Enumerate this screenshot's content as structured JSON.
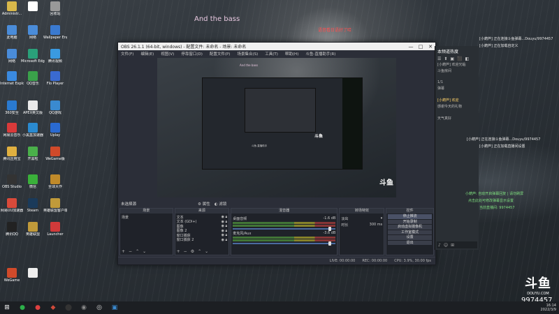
{
  "lyric": "And the bass",
  "danmaku": [
    {
      "text": "语音看日语好了哈",
      "color": "#ff5050"
    }
  ],
  "desktop_icons": [
    {
      "label": "Administr...",
      "color": "#d9b84a"
    },
    {
      "label": "此电脑",
      "color": "#4a8cd9"
    },
    {
      "label": "网络",
      "color": "#4a8cd9"
    },
    {
      "label": "Internet Explorer",
      "color": "#3a8ae0"
    },
    {
      "label": "360安全",
      "color": "#2a7ad0"
    },
    {
      "label": "网易云音乐",
      "color": "#d93a3a"
    },
    {
      "label": "腾讯应用宝",
      "color": "#e0b040"
    },
    {
      "label": "OBS Studio",
      "color": "#333"
    },
    {
      "label": "网易UU加速器",
      "color": "#d94a3a"
    },
    {
      "label": "腾讯QQ",
      "color": "#222"
    },
    {
      "label": "WeGame",
      "color": "#d04a2a"
    },
    {
      "label": "",
      "color": "#ffffff"
    },
    {
      "label": "网络",
      "color": "#4a8cd9"
    },
    {
      "label": "Microsoft Edge",
      "color": "#2aa07a"
    },
    {
      "label": "QQ音乐",
      "color": "#3aa04a"
    },
    {
      "label": "APEX英文版",
      "color": "#eaeaea"
    },
    {
      "label": "小黑盒加速器",
      "color": "#2a8ad0"
    },
    {
      "label": "开黑啦",
      "color": "#4ab04a"
    },
    {
      "label": "微信",
      "color": "#3ab03a"
    },
    {
      "label": "Steam",
      "color": "#1a3a5a"
    },
    {
      "label": "英雄联盟",
      "color": "#c09a3a"
    },
    {
      "label": "",
      "color": "#eeeeee"
    },
    {
      "label": "回收站",
      "color": "#999999"
    },
    {
      "label": "Wallpaper Engine",
      "color": "#3a7ad0"
    },
    {
      "label": "腾讯视频",
      "color": "#3a9ae0"
    },
    {
      "label": "Flo Player",
      "color": "#3a6ad0"
    },
    {
      "label": "QQ游戏",
      "color": "#3a8ad0"
    },
    {
      "label": "Uplay",
      "color": "#2a6ad0"
    },
    {
      "label": "WeGame版",
      "color": "#d04a2a"
    },
    {
      "label": "全球大作",
      "color": "#c08a2a"
    },
    {
      "label": "英雄联盟客户端",
      "color": "#c09a3a"
    },
    {
      "label": "Launcher",
      "color": "#d03a3a"
    }
  ],
  "obs": {
    "title": "OBS 26.1.1 (64-bit, windows) - 配置文件: 未命名 - 场景: 未命名",
    "menu": [
      "文件(F)",
      "编辑(E)",
      "视图(V)",
      "停靠窗口(D)",
      "配置文件(P)",
      "场景集合(S)",
      "工具(T)",
      "帮助(H)",
      "斗鱼-直播助手(R)"
    ],
    "window_buttons": [
      "—",
      "□",
      "✕"
    ],
    "preview_lyric": "And the bass",
    "preview_logo": "斗鱼",
    "nested_logo": "斗鱼",
    "nested_label": "斗鱼-直播助手",
    "program_label": "未选择源",
    "program_buttons": [
      "属性",
      "滤镜"
    ],
    "docks": {
      "scenes": {
        "header": "场景",
        "items": [
          "场景"
        ]
      },
      "sources": {
        "header": "来源",
        "items": [
          "文本",
          "文本 (GDI+)",
          "图像",
          "图像 2",
          "窗口捕获",
          "窗口捕获 2"
        ]
      },
      "mixer": {
        "header": "混音器",
        "tracks": [
          {
            "name": "桌面音频",
            "db": "-1.6 dB"
          },
          {
            "name": "麦克风/Aux",
            "db": "-3.6 dB"
          }
        ]
      },
      "transitions": {
        "header": "转场特效",
        "type": "淡出",
        "duration_label": "时长",
        "duration_value": "300 ms"
      },
      "controls": {
        "header": "控件",
        "buttons": [
          "停止推流",
          "开始录制",
          "启动虚拟摄像机",
          "工作室模式",
          "设置",
          "退出"
        ]
      }
    },
    "status": [
      "LIVE: 00:00:00",
      "REC: 00:00:00",
      "CPU: 3.9%, 30.00 fps"
    ]
  },
  "chat": {
    "title": "本频道热度",
    "tools": [
      "☰",
      "⬆",
      "▣",
      "⬛",
      "◧"
    ],
    "lines": [
      {
        "text": "[小葫芦] 欢迎光临",
        "hl": false
      },
      {
        "text": "斗鱼房间",
        "hl": false
      },
      {
        "text": "",
        "hl": false
      },
      {
        "text": "1/1",
        "hl": false
      },
      {
        "text": "弹幕",
        "hl": false
      },
      {
        "text": "",
        "hl": false
      },
      {
        "text": "[小葫芦] 欢迎",
        "hl": true
      },
      {
        "text": "感谢今天的礼物",
        "hl": false
      },
      {
        "text": "",
        "hl": false
      },
      {
        "text": "天气真好",
        "hl": false
      }
    ],
    "input_icons": [
      "♪",
      "☺",
      "⊞"
    ]
  },
  "side_messages": [
    {
      "text": "[小葫芦] 正在连接斗鱼弹幕...Douyu/9974457",
      "color": "#e8e8e8"
    },
    {
      "text": "[小葫芦] 正在加载自定义",
      "color": "#e8e8e8"
    },
    {
      "text": "[小葫芦] 正在连接斗鱼弹幕...Douyu/9974457",
      "color": "#e8e8e8"
    },
    {
      "text": "[小葫芦] 正在加载直播间设置",
      "color": "#e8e8e8"
    },
    {
      "text": "小葫芦: 自动开启弹幕回复 | 请勿刷屏",
      "color": "#7fe07f"
    },
    {
      "text": "点击此处可修改弹幕显示设置",
      "color": "#7fe07f"
    },
    {
      "text": "当前直播间: 9974457",
      "color": "#7fe07f"
    }
  ],
  "douyu": {
    "logo": "斗鱼",
    "sub": "DOUYU.COM",
    "room": "9974457"
  },
  "taskbar": {
    "icons": [
      "⊞",
      "●",
      "●",
      "◆",
      "⬤",
      "◉",
      "◎",
      "▣"
    ],
    "tray_time": "16:14",
    "tray_date": "2022/3/9"
  }
}
